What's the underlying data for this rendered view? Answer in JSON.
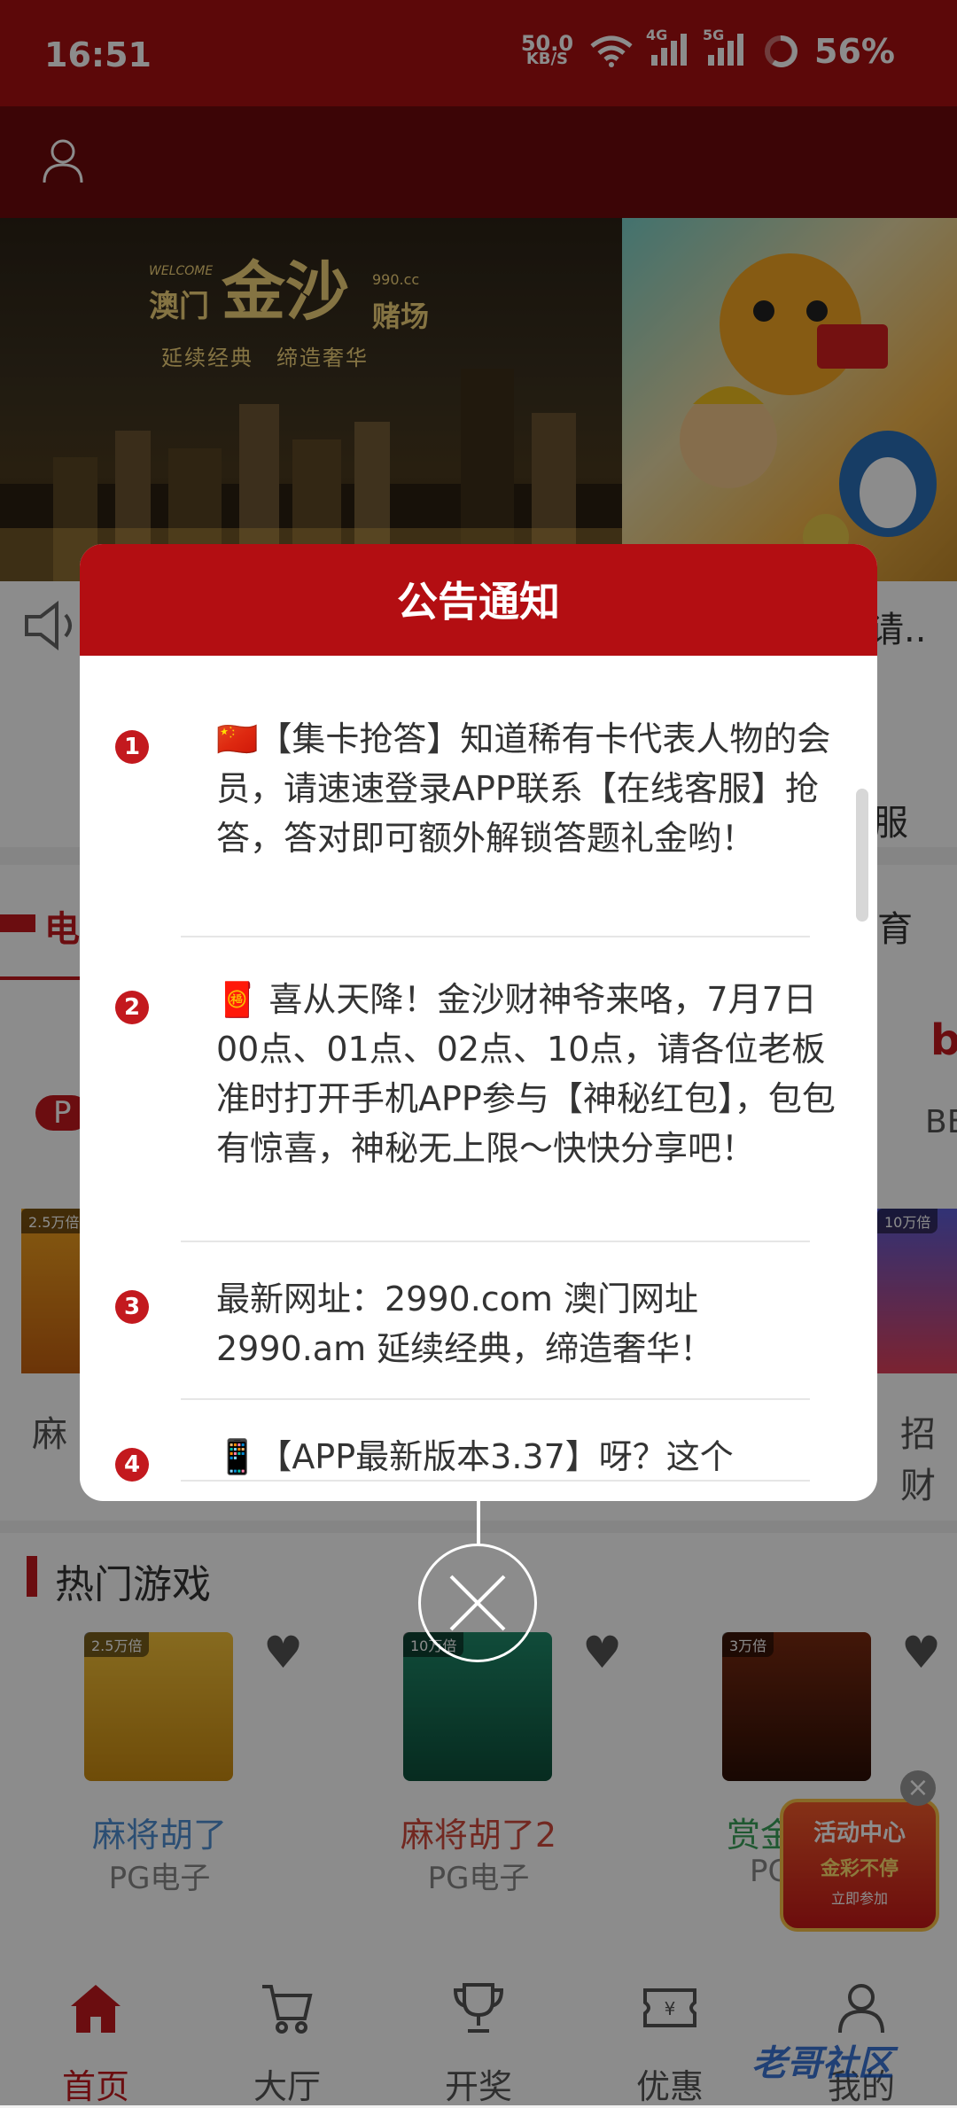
{
  "status_bar": {
    "time": "16:51",
    "net_speed_value": "50.0",
    "net_speed_unit": "KB/S",
    "net_4g": "4G",
    "net_5g": "5G",
    "battery": "56%"
  },
  "banner1": {
    "welcome": "WELCOME",
    "city": "澳门",
    "brand": "金沙",
    "casino": "赌场",
    "domain": "990.cc",
    "slogan": "延续经典　缔造奢华"
  },
  "underlay": {
    "notice_tail": "请..",
    "service_tail": "服",
    "tab_left": "电",
    "tab_right": "育",
    "row_left_badge": "2.5万倍",
    "row_left_name": "麻",
    "row_right_badge": "10万倍",
    "row_right_name": "招财",
    "provider_left": "P",
    "provider_right": "BB",
    "hot_games_title": "热门游戏"
  },
  "games": [
    {
      "name": "麻将胡了",
      "provider": "PG电子",
      "badge": "2.5万倍",
      "name_color": "#4f8fd1"
    },
    {
      "name": "麻将胡了2",
      "provider": "PG电子",
      "badge": "10万倍",
      "name_color": "#d04a3c"
    },
    {
      "name": "赏金",
      "provider": "PG",
      "badge": "3万倍",
      "name_color": "#3aa05a"
    }
  ],
  "dialog": {
    "title": "公告通知",
    "items": [
      {
        "num": "1",
        "text": "🇨🇳【集卡抢答】知道稀有卡代表人物的会员，请速速登录APP联系【在线客服】抢答，答对即可额外解锁答题礼金哟！"
      },
      {
        "num": "2",
        "text": "🧧 喜从天降！金沙财神爷来咯，7月7日00点、01点、02点、10点，请各位老板准时打开手机APP参与【神秘红包】，包包有惊喜，神秘无上限～快快分享吧！"
      },
      {
        "num": "3",
        "text": "最新网址：2990.com 澳门网址2990.am 延续经典，缔造奢华！"
      },
      {
        "num": "4",
        "text": "📱【APP最新版本3.37】呀？这个"
      }
    ]
  },
  "activity_badge": {
    "title": "活动中心",
    "subtitle": "金彩不停",
    "cta": "立即参加"
  },
  "nav": [
    {
      "label": "首页",
      "icon": "home-icon"
    },
    {
      "label": "大厅",
      "icon": "cart-icon"
    },
    {
      "label": "开奖",
      "icon": "trophy-icon"
    },
    {
      "label": "优惠",
      "icon": "coupon-icon"
    },
    {
      "label": "我的",
      "icon": "person-icon"
    }
  ],
  "watermark": "老哥社区",
  "colors": {
    "primary": "#b30e12",
    "status_bar": "#a80f12",
    "header": "#6d0a0c"
  }
}
